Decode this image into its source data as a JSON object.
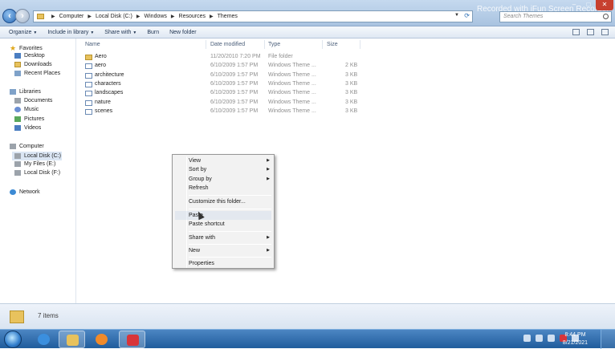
{
  "window": {
    "address_crumbs": [
      "Computer",
      "Local Disk (C:)",
      "Windows",
      "Resources",
      "Themes"
    ],
    "search_placeholder": "Search Themes",
    "watermark": "Recorded with iFun Screen Recorder"
  },
  "toolbar": {
    "organize": "Organize",
    "include_in_library": "Include in library",
    "share_with": "Share with",
    "burn": "Burn",
    "new_folder": "New folder"
  },
  "nav": {
    "favorites": "Favorites",
    "desktop": "Desktop",
    "downloads": "Downloads",
    "recent_places": "Recent Places",
    "libraries": "Libraries",
    "documents": "Documents",
    "music": "Music",
    "pictures": "Pictures",
    "videos": "Videos",
    "computer": "Computer",
    "local_disk_c": "Local Disk (C:)",
    "my_files_e": "My Files (E:)",
    "local_disk_f": "Local Disk (F:)",
    "network": "Network"
  },
  "columns": {
    "name": "Name",
    "date_modified": "Date modified",
    "type": "Type",
    "size": "Size"
  },
  "files": [
    {
      "name": "Aero",
      "date": "11/20/2010 7:20 PM",
      "type": "File folder",
      "size": "",
      "icon": "folder"
    },
    {
      "name": "aero",
      "date": "6/10/2009 1:57 PM",
      "type": "Windows Theme ...",
      "size": "2 KB",
      "icon": "theme"
    },
    {
      "name": "architecture",
      "date": "6/10/2009 1:57 PM",
      "type": "Windows Theme ...",
      "size": "3 KB",
      "icon": "theme"
    },
    {
      "name": "characters",
      "date": "6/10/2009 1:57 PM",
      "type": "Windows Theme ...",
      "size": "3 KB",
      "icon": "theme"
    },
    {
      "name": "landscapes",
      "date": "6/10/2009 1:57 PM",
      "type": "Windows Theme ...",
      "size": "3 KB",
      "icon": "theme"
    },
    {
      "name": "nature",
      "date": "6/10/2009 1:57 PM",
      "type": "Windows Theme ...",
      "size": "3 KB",
      "icon": "theme"
    },
    {
      "name": "scenes",
      "date": "6/10/2009 1:57 PM",
      "type": "Windows Theme ...",
      "size": "3 KB",
      "icon": "theme"
    }
  ],
  "context_menu": {
    "view": "View",
    "sort_by": "Sort by",
    "group_by": "Group by",
    "refresh": "Refresh",
    "customize": "Customize this folder...",
    "paste": "Paste",
    "paste_shortcut": "Paste shortcut",
    "share_with": "Share with",
    "new": "New",
    "properties": "Properties"
  },
  "details": {
    "item_count": "7 items"
  },
  "taskbar": {
    "time": "8:44 PM",
    "date": "8/21/2021"
  }
}
